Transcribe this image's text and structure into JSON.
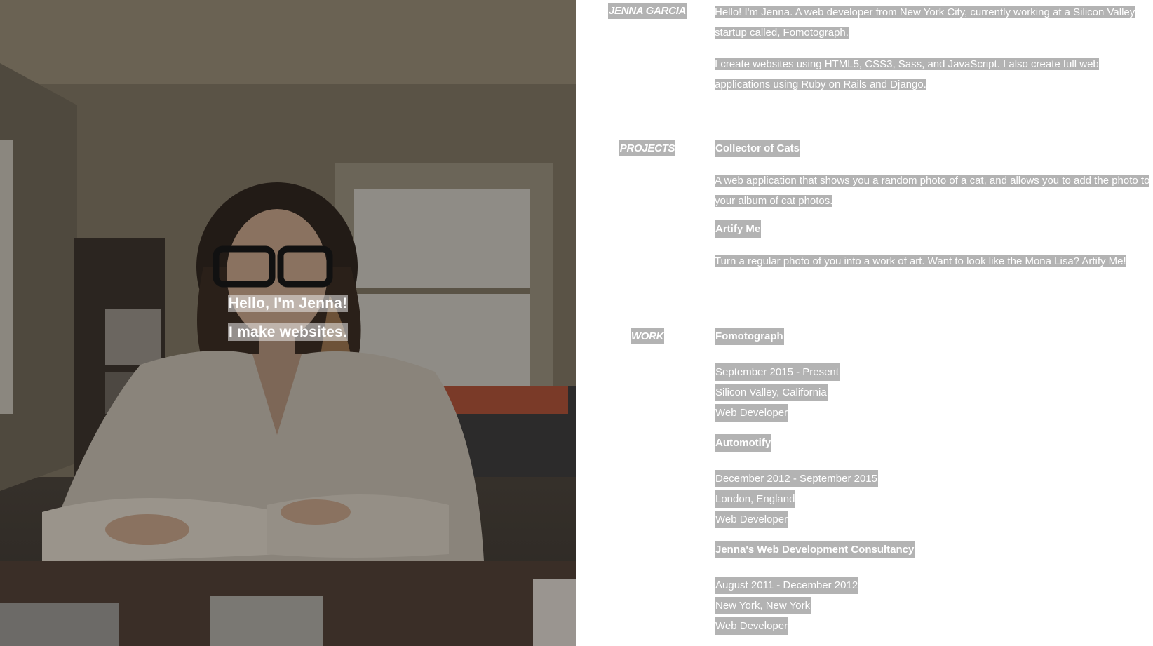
{
  "hero": {
    "line1": "Hello, I'm Jenna!",
    "line2": "I make websites."
  },
  "about": {
    "label": "JENNA GARCIA",
    "paragraphs": [
      "Hello! I'm Jenna. A web developer from New York City, currently working at a Silicon Valley startup called, Fomotograph.",
      "I create websites using HTML5, CSS3, Sass, and JavaScript. I also create full web applications using Ruby on Rails and Django."
    ]
  },
  "projects": {
    "label": "PROJECTS",
    "items": [
      {
        "title": "Collector of Cats",
        "description": "A web application that shows you a random photo of a cat, and allows you to add the photo to your album of cat photos."
      },
      {
        "title": "Artify Me",
        "description": "Turn a regular photo of you into a work of art. Want to look like the Mona Lisa? Artify Me!"
      }
    ]
  },
  "work": {
    "label": "WORK",
    "items": [
      {
        "company": "Fomotograph",
        "dates": "September 2015 - Present",
        "location": "Silicon Valley, California",
        "role": "Web Developer"
      },
      {
        "company": "Automotify",
        "dates": "December 2012 - September 2015",
        "location": "London, England",
        "role": "Web Developer"
      },
      {
        "company": "Jenna's Web Development Consultancy",
        "dates": "August 2011 - December 2012",
        "location": "New York, New York",
        "role": "Web Developer"
      }
    ]
  },
  "colors": {
    "highlight": "#b3b3b3",
    "text_on_highlight": "#ffffff",
    "background": "#ffffff"
  }
}
